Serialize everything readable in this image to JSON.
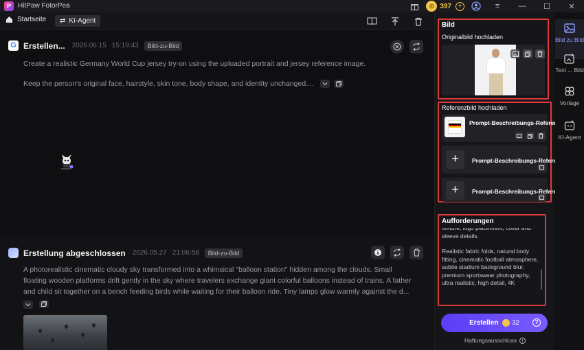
{
  "app": {
    "title": "HitPaw FotorPea",
    "logo_letter": "P",
    "credits": "397"
  },
  "nav": {
    "home_label": "Startseite",
    "agent_label": "KI-Agent"
  },
  "cards": [
    {
      "title": "Erstellen...",
      "date": "2026.06.15",
      "time": "15:19:43",
      "badge": "Bild-zu-Bild",
      "prompt_line1": "Create a realistic Germany World Cup jersey try-on using the uploaded portrait and jersey reference image.",
      "prompt_line2": "Keep the person's original face, hairstyle, skin tone, body shape, and identity unchanged...."
    },
    {
      "title": "Erstellung abgeschlossen",
      "date": "2026.05.27",
      "time": "21:06:58",
      "badge": "Bild-zu-Bild",
      "prompt_line1": "A photorealistic cinematic cloudy sky transformed into a whimsical \"balloon station\" hidden among the clouds. Small",
      "prompt_line2": "floating wooden platforms drift gently in the sky where travelers exchange giant colorful balloons instead of trains. A father",
      "prompt_line3": "and child sit together on a bench feeding birds while waiting for their balloon ride. Tiny lamps glow warmly against the d..."
    }
  ],
  "panel": {
    "bild_title": "Bild",
    "original_label": "Originalbild hochladen",
    "reference_label": "Referenzbild hochladen",
    "ref_items": [
      {
        "label": "Prompt-Beschreibungs-Referenz"
      },
      {
        "label": "Prompt-Beschreibungs-Referenz"
      },
      {
        "label": "Prompt-Beschreibungs-Referenz"
      }
    ],
    "prompt_title": "Aufforderungen",
    "prompt_text_1": "texture, logo placement, collar and sleeve details.",
    "prompt_text_2": "Realistic fabric folds, natural body fitting, cinematic football atmosphere, subtle stadium background blur, premium sportswear photography, ultra realistic, high detail, 4K",
    "create_label": "Erstellen",
    "create_cost": "32",
    "disclaimer": "Haftungsausschluss"
  },
  "rail": [
    {
      "label": "Bild zu Bild",
      "icon": "image-icon"
    },
    {
      "label": "Text ... Bild",
      "icon": "text-to-image-icon"
    },
    {
      "label": "Vorlage",
      "icon": "template-icon"
    },
    {
      "label": "KI-Agent",
      "icon": "ai-agent-icon"
    }
  ],
  "colors": {
    "accent": "#6a4cff",
    "highlight_border": "#e03b3b",
    "coin": "#f3c64a"
  }
}
